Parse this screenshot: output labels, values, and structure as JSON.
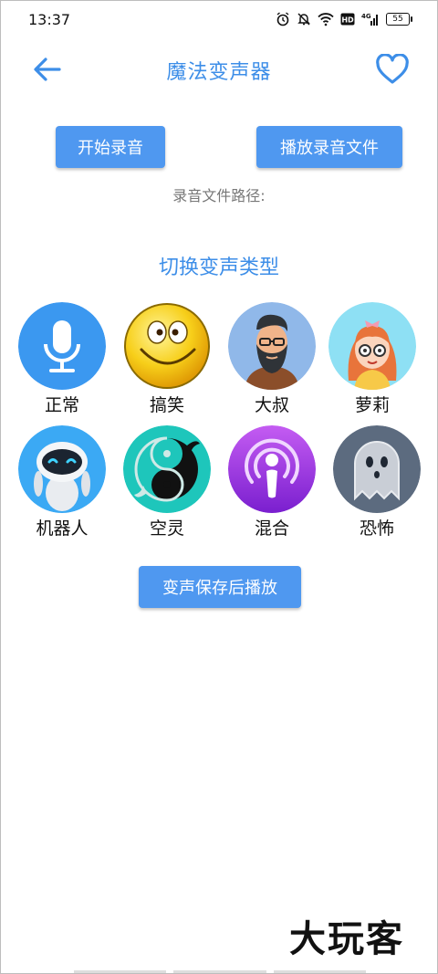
{
  "status_bar": {
    "time": "13:37",
    "battery": "55"
  },
  "header": {
    "title": "魔法变声器"
  },
  "buttons": {
    "record": "开始录音",
    "play_record": "播放录音文件",
    "save_play": "变声保存后播放"
  },
  "path_label": "录音文件路径:",
  "section_title": "切换变声类型",
  "voices": [
    {
      "label": "正常",
      "icon": "microphone-icon",
      "color": "#3b98f0"
    },
    {
      "label": "搞笑",
      "icon": "laughing-emoji-icon",
      "color": "#f7cf1a"
    },
    {
      "label": "大叔",
      "icon": "bearded-man-icon",
      "color": "#90b8e9"
    },
    {
      "label": "萝莉",
      "icon": "girl-icon",
      "color": "#8ee0f4"
    },
    {
      "label": "机器人",
      "icon": "robot-icon",
      "color": "#3ba9f4"
    },
    {
      "label": "空灵",
      "icon": "yin-yang-fish-icon",
      "color": "#1ec6bb"
    },
    {
      "label": "混合",
      "icon": "podcast-icon",
      "color": "#9b35df"
    },
    {
      "label": "恐怖",
      "icon": "ghost-icon",
      "color": "#5c6b7f"
    }
  ],
  "watermark": "大玩客",
  "colors": {
    "accent": "#3d8ee8",
    "button": "#4f98f0"
  }
}
